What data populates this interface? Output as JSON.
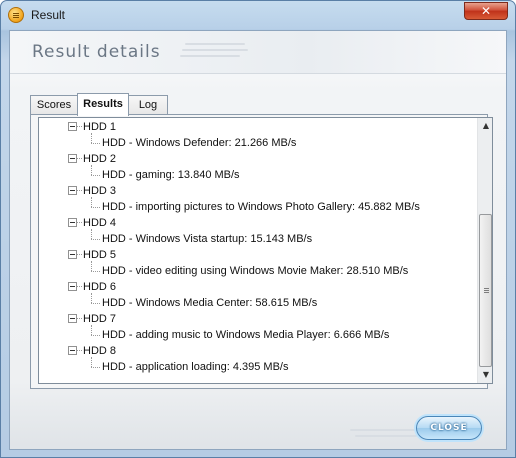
{
  "window": {
    "title": "Result",
    "close_glyph": "✕"
  },
  "header": {
    "title": "Result details"
  },
  "tabs": [
    {
      "label": "Scores"
    },
    {
      "label": "Results",
      "active": true
    },
    {
      "label": "Log"
    }
  ],
  "tree": [
    {
      "group": "HDD 1",
      "item": "HDD - Windows Defender: 21.266 MB/s"
    },
    {
      "group": "HDD 2",
      "item": "HDD - gaming: 13.840 MB/s"
    },
    {
      "group": "HDD 3",
      "item": "HDD - importing pictures to Windows Photo Gallery: 45.882 MB/s"
    },
    {
      "group": "HDD 4",
      "item": "HDD - Windows Vista startup: 15.143 MB/s"
    },
    {
      "group": "HDD 5",
      "item": "HDD - video editing using Windows Movie Maker: 28.510 MB/s"
    },
    {
      "group": "HDD 6",
      "item": "HDD - Windows Media Center: 58.615 MB/s"
    },
    {
      "group": "HDD 7",
      "item": "HDD - adding music to Windows Media Player: 6.666 MB/s"
    },
    {
      "group": "HDD 8",
      "item": "HDD - application loading: 4.395 MB/s"
    }
  ],
  "scrollbar": {
    "up_glyph": "▲",
    "down_glyph": "▼",
    "position": 0.36
  },
  "footer": {
    "close_label": "CLOSE"
  },
  "icons": {
    "app": "app-icon",
    "window_close": "close-icon",
    "expander": "collapse-minus-icon"
  },
  "colors": {
    "accent": "#9ccbec",
    "title_close": "#c0311a",
    "header_text": "#6b7785"
  }
}
